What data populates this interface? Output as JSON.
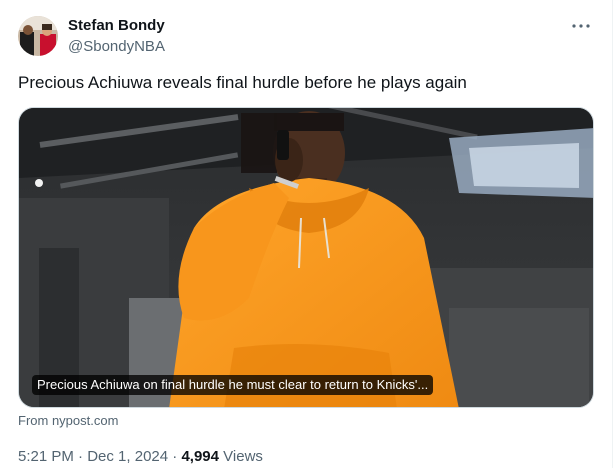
{
  "author": {
    "name": "Stefan Bondy",
    "handle": "@SbondyNBA"
  },
  "icons": {
    "more": "more-horizontal-icon"
  },
  "tweet": {
    "text": "Precious Achiuwa reveals final hurdle before he plays again"
  },
  "card": {
    "caption": "Precious Achiuwa on final hurdle he must clear to return to Knicks'...",
    "source": "From nypost.com"
  },
  "meta": {
    "time": "5:21 PM",
    "separator1": " · ",
    "date": "Dec 1, 2024",
    "separator2": " · ",
    "views_count": "4,994",
    "views_label": " Views"
  },
  "colors": {
    "text_primary": "#0f1419",
    "text_secondary": "#536471",
    "border": "#cfd9de",
    "hoodie": "#f7941d"
  }
}
